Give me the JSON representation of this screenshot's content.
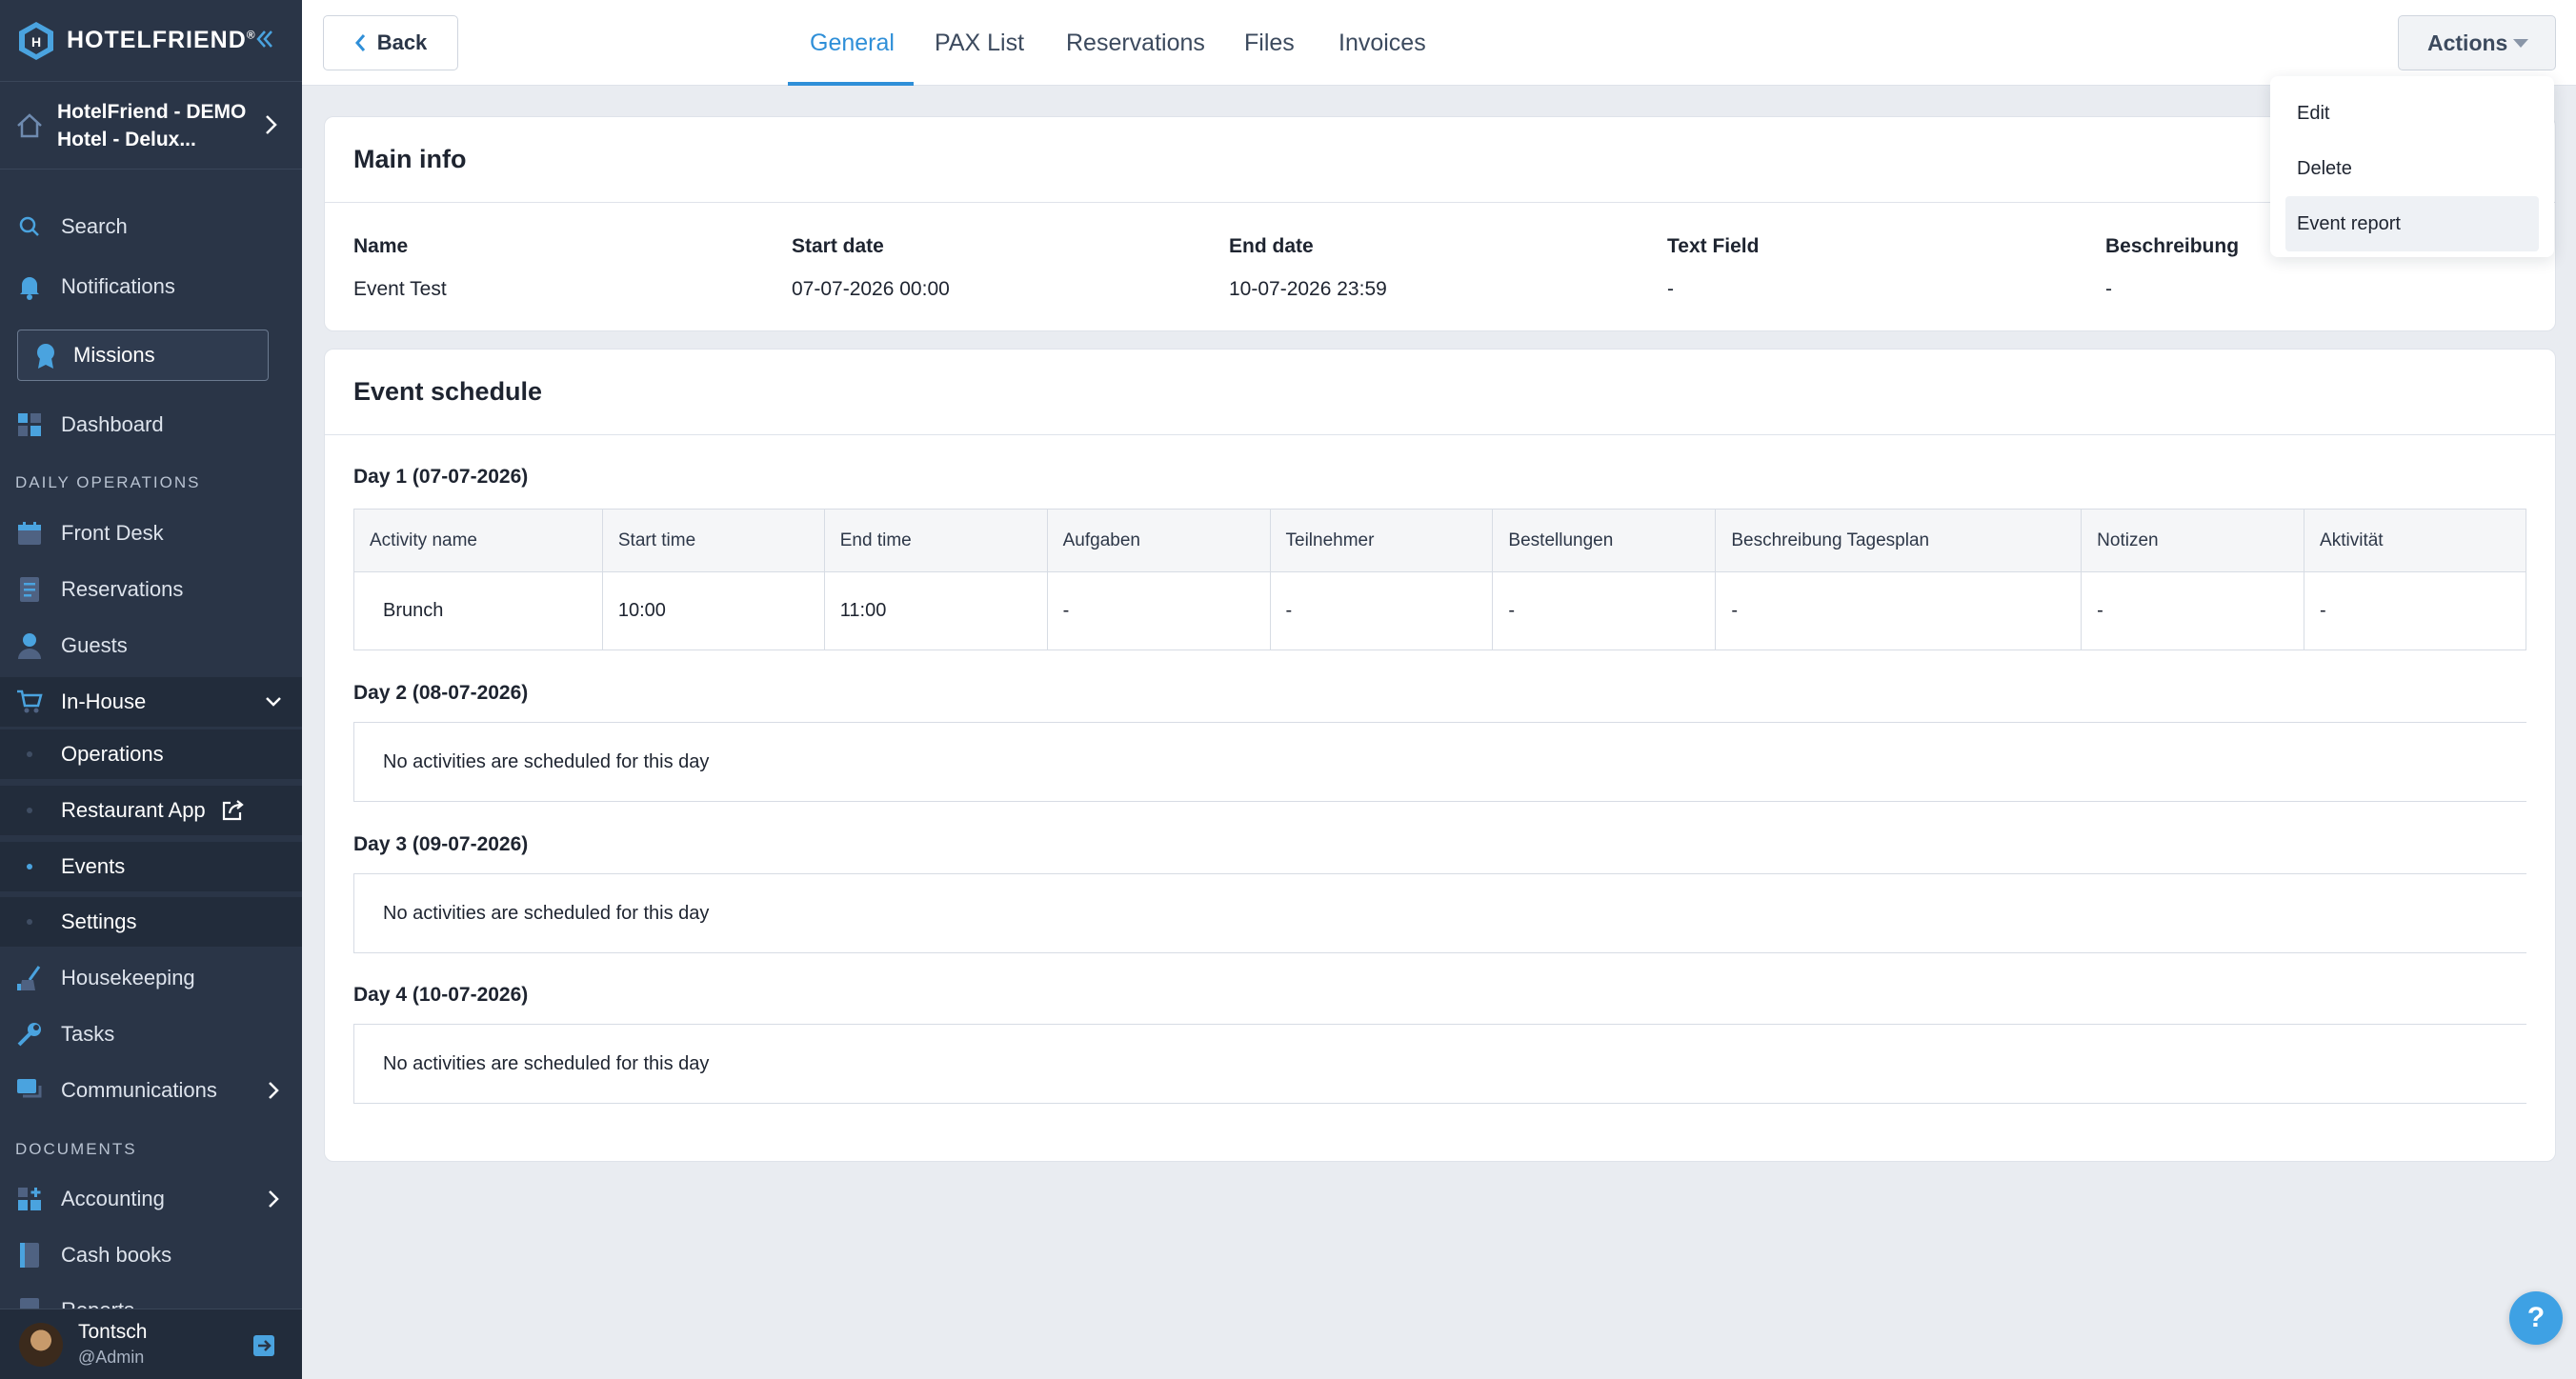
{
  "brand": {
    "name": "HOTELFRIEND",
    "mark": "®"
  },
  "hotel": {
    "name": "HotelFriend - DEMO Hotel - Delux..."
  },
  "sidebar": {
    "search": "Search",
    "notifications": "Notifications",
    "missions": "Missions",
    "dashboard": "Dashboard",
    "section_daily": "DAILY OPERATIONS",
    "front_desk": "Front Desk",
    "reservations": "Reservations",
    "guests": "Guests",
    "in_house": "In-House",
    "sub_operations": "Operations",
    "sub_restaurant": "Restaurant App",
    "sub_events": "Events",
    "sub_settings": "Settings",
    "housekeeping": "Housekeeping",
    "tasks": "Tasks",
    "communications": "Communications",
    "section_documents": "DOCUMENTS",
    "accounting": "Accounting",
    "cash_books": "Cash books",
    "reports": "Reports"
  },
  "user": {
    "name": "Tontsch",
    "role": "@Admin"
  },
  "topbar": {
    "back": "Back",
    "tabs": [
      "General",
      "PAX List",
      "Reservations",
      "Files",
      "Invoices"
    ],
    "actions": "Actions"
  },
  "dropdown": {
    "items": [
      "Edit",
      "Delete",
      "Event report"
    ]
  },
  "main_info": {
    "title": "Main info",
    "fields": [
      {
        "label": "Name",
        "value": "Event Test"
      },
      {
        "label": "Start date",
        "value": "07-07-2026 00:00"
      },
      {
        "label": "End date",
        "value": "10-07-2026 23:59"
      },
      {
        "label": "Text Field",
        "value": "-"
      },
      {
        "label": "Beschreibung",
        "value": "-"
      }
    ]
  },
  "schedule": {
    "title": "Event schedule",
    "columns": [
      "Activity name",
      "Start time",
      "End time",
      "Aufgaben",
      "Teilnehmer",
      "Bestellungen",
      "Beschreibung Tagesplan",
      "Notizen",
      "Aktivität"
    ],
    "days": [
      {
        "title": "Day 1 (07-07-2026)",
        "rows": [
          [
            "Brunch",
            "10:00",
            "11:00",
            "-",
            "-",
            "-",
            "-",
            "-",
            "-"
          ]
        ]
      },
      {
        "title": "Day 2 (08-07-2026)",
        "empty": "No activities are scheduled for this day"
      },
      {
        "title": "Day 3 (09-07-2026)",
        "empty": "No activities are scheduled for this day"
      },
      {
        "title": "Day 4 (10-07-2026)",
        "empty": "No activities are scheduled for this day"
      }
    ]
  },
  "help": "?",
  "colors": {
    "accent": "#2f8fd8",
    "sidebar": "#2a3547"
  }
}
